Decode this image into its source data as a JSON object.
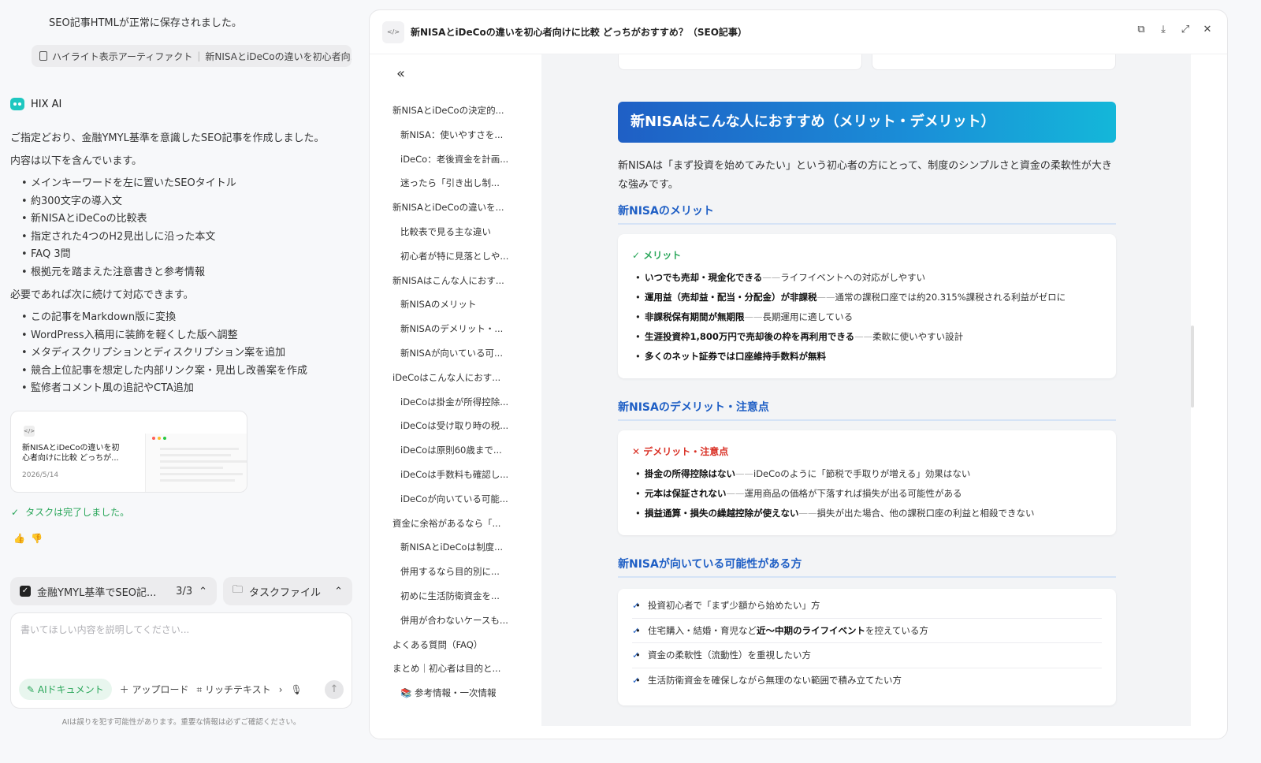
{
  "chat": {
    "prev_message": "SEO記事HTMLが正常に保存されました。",
    "artifact_chip": {
      "label": "ハイライト表示アーティファクト",
      "separator": "|",
      "title": "新NISAとiDeCoの違いを初心者向..."
    },
    "brand": "HIX AI",
    "message": {
      "p1": "ご指定どおり、金融YMYL基準を意識したSEO記事を作成しました。",
      "p2": "内容は以下を含んでいます。",
      "list1": [
        "メインキーワードを左に置いたSEOタイトル",
        "約300文字の導入文",
        "新NISAとiDeCoの比較表",
        "指定された4つのH2見出しに沿った本文",
        "FAQ 3問",
        "根拠元を踏まえた注意書きと参考情報"
      ],
      "p3": "必要であれば次に続けて対応できます。",
      "list2": [
        "この記事をMarkdown版に変換",
        "WordPress入稿用に装飾を軽くした版へ調整",
        "メタディスクリプションとディスクリプション案を追加",
        "競合上位記事を想定した内部リンク案・見出し改善案を作成",
        "監修者コメント風の追記やCTA追加"
      ]
    },
    "file_card": {
      "icon": "</>",
      "title": "新NISAとiDeCoの違いを初心者向けに比較 どっちが...",
      "date": "2026/5/14"
    },
    "task_done": "タスクは完了しました。",
    "task_pill": {
      "label": "金融YMYL基準でSEO記...",
      "count": "3/3"
    },
    "files_pill": {
      "label": "タスクファイル"
    },
    "composer": {
      "placeholder": "書いてほしい内容を説明してください...",
      "ai_doc": "AIドキュメント",
      "upload": "アップロード",
      "rich_text": "リッチテキスト"
    },
    "disclaimer": "AIは誤りを犯す可能性があります。重要な情報は必ずご確認ください。"
  },
  "artifact": {
    "file_icon": "</>",
    "title": "新NISAとiDeCoの違いを初心者向けに比較 どっちがおすすめ？（SEO記事）",
    "toc": [
      {
        "label": "新NISAとiDeCoの決定的...",
        "level": 1
      },
      {
        "label": "新NISA：使いやすさを...",
        "level": 2
      },
      {
        "label": "iDeCo：老後資金を計画...",
        "level": 2
      },
      {
        "label": "迷ったら「引き出し制...",
        "level": 2
      },
      {
        "label": "新NISAとiDeCoの違いを...",
        "level": 1
      },
      {
        "label": "比較表で見る主な違い",
        "level": 2
      },
      {
        "label": "初心者が特に見落としや...",
        "level": 2
      },
      {
        "label": "新NISAはこんな人におす...",
        "level": 1
      },
      {
        "label": "新NISAのメリット",
        "level": 2
      },
      {
        "label": "新NISAのデメリット・...",
        "level": 2
      },
      {
        "label": "新NISAが向いている可...",
        "level": 2
      },
      {
        "label": "iDeCoはこんな人におす...",
        "level": 1
      },
      {
        "label": "iDeCoは掛金が所得控除...",
        "level": 2
      },
      {
        "label": "iDeCoは受け取り時の税...",
        "level": 2
      },
      {
        "label": "iDeCoは原則60歳まで...",
        "level": 2
      },
      {
        "label": "iDeCoは手数料も確認し...",
        "level": 2
      },
      {
        "label": "iDeCoが向いている可能...",
        "level": 2
      },
      {
        "label": "資金に余裕があるなら「...",
        "level": 1
      },
      {
        "label": "新NISAとiDeCoは制度...",
        "level": 2
      },
      {
        "label": "併用するなら目的別に...",
        "level": 2
      },
      {
        "label": "初めに生活防衛資金を...",
        "level": 2
      },
      {
        "label": "併用が合わないケースも...",
        "level": 2
      },
      {
        "label": "よくある質問（FAQ）",
        "level": 1
      },
      {
        "label": "まとめ｜初心者は目的と...",
        "level": 1
      },
      {
        "label": "📚 参考情報・一次情報",
        "level": 2
      }
    ],
    "content": {
      "h2": "新NISAはこんな人におすすめ（メリット・デメリット）",
      "intro": "新NISAは「まず投資を始めてみたい」という初心者の方にとって、制度のシンプルさと資金の柔軟性が大きな強みです。",
      "merit": {
        "heading": "新NISAのメリット",
        "label": "✓ メリット",
        "items": [
          {
            "bold": "いつでも売却・現金化できる",
            "rest": "ライフイベントへの対応がしやすい"
          },
          {
            "bold": "運用益（売却益・配当・分配金）が非課税",
            "rest": "通常の課税口座では約20.315%課税される利益がゼロに"
          },
          {
            "bold": "非課税保有期間が無期限",
            "rest": "長期運用に適している"
          },
          {
            "bold": "生涯投資枠1,800万円で売却後の枠を再利用できる",
            "rest": "柔軟に使いやすい設計"
          },
          {
            "bold": "多くのネット証券では口座維持手数料が無料",
            "rest": ""
          }
        ]
      },
      "demerit": {
        "heading": "新NISAのデメリット・注意点",
        "label": "✕ デメリット・注意点",
        "items": [
          {
            "bold": "掛金の所得控除はない",
            "rest": "iDeCoのように「節税で手取りが増える」効果はない"
          },
          {
            "bold": "元本は保証されない",
            "rest": "運用商品の価格が下落すれば損失が出る可能性がある"
          },
          {
            "bold": "損益通算・損失の繰越控除が使えない",
            "rest": "損失が出た場合、他の課税口座の利益と相殺できない"
          }
        ]
      },
      "suited": {
        "heading": "新NISAが向いている可能性がある方",
        "items": [
          {
            "pre": "投資初心者で「まず少額から始めたい」方",
            "bold": "",
            "post": ""
          },
          {
            "pre": "住宅購入・結婚・育児など",
            "bold": "近〜中期のライフイベント",
            "post": "を控えている方"
          },
          {
            "pre": "資金の柔軟性（流動性）を重視したい方",
            "bold": "",
            "post": ""
          },
          {
            "pre": "生活防衛資金を確保しながら無理のない範囲で積み立てたい方",
            "bold": "",
            "post": ""
          }
        ]
      }
    }
  },
  "colors": {
    "accent": "#1f5fc5",
    "success": "#2aa65a",
    "danger": "#d93025",
    "brand": "#1ec7c0"
  }
}
